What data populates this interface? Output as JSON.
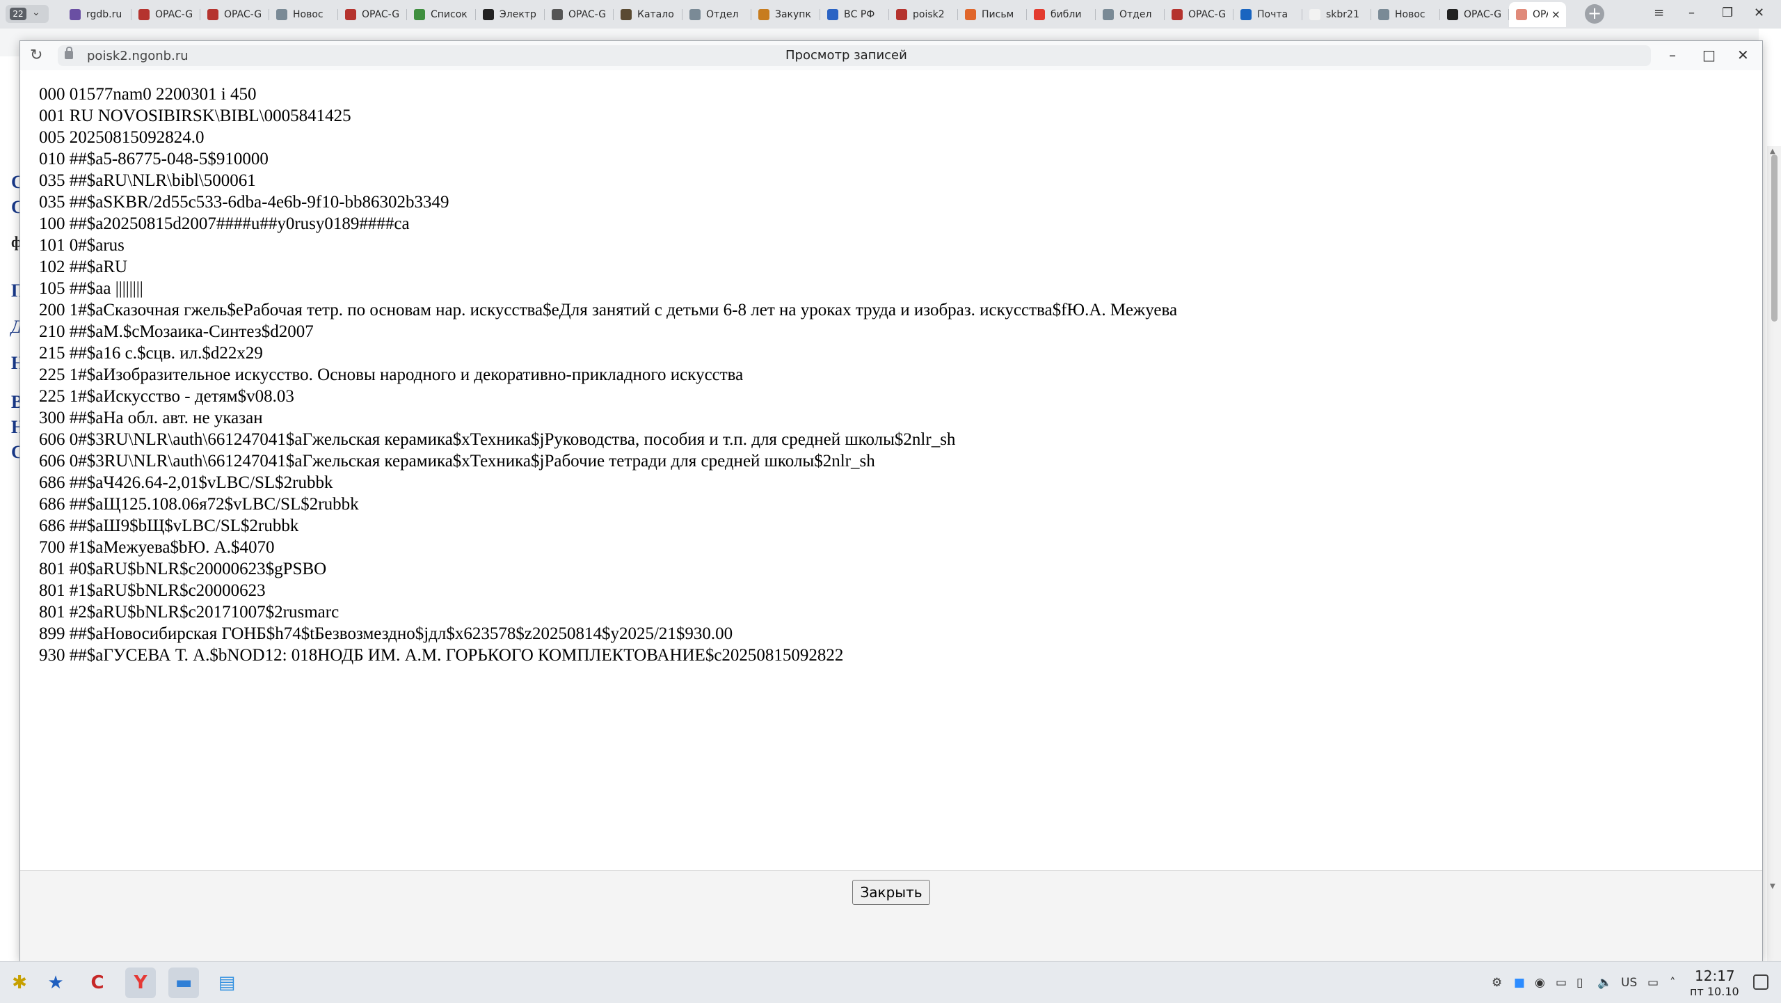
{
  "browser": {
    "tab_count": "22",
    "tabs": [
      {
        "label": "rgdb.ru",
        "icon": "globe-icon",
        "color": "#6a4fa3"
      },
      {
        "label": "OPAC-G",
        "icon": "opac-icon",
        "color": "#b5332e"
      },
      {
        "label": "OPAC-G",
        "icon": "opac-icon",
        "color": "#b5332e"
      },
      {
        "label": "Новос",
        "icon": "page-icon",
        "color": "#7a8a96"
      },
      {
        "label": "OPAC-G",
        "icon": "opac-icon",
        "color": "#b5332e"
      },
      {
        "label": "Список",
        "icon": "leaf-icon",
        "color": "#3f8f3f"
      },
      {
        "label": "Электр",
        "icon": "mail-icon",
        "color": "#222222"
      },
      {
        "label": "OPAC-G",
        "icon": "document-icon",
        "color": "#555555"
      },
      {
        "label": "Катало",
        "icon": "catalog-icon",
        "color": "#5a4a32"
      },
      {
        "label": "Отдел",
        "icon": "page-icon",
        "color": "#7a8a96"
      },
      {
        "label": "Закупк",
        "icon": "procurement-icon",
        "color": "#c77c1e"
      },
      {
        "label": "ВС РФ",
        "icon": "court-icon",
        "color": "#2a63c4"
      },
      {
        "label": "poisk2",
        "icon": "opac-icon",
        "color": "#b5332e"
      },
      {
        "label": "Письм",
        "icon": "mail-icon",
        "color": "#e0662b"
      },
      {
        "label": "библи",
        "icon": "yandex-icon",
        "color": "#e33b2e"
      },
      {
        "label": "Отдел",
        "icon": "page-icon",
        "color": "#7a8a96"
      },
      {
        "label": "OPAC-G",
        "icon": "opac-icon",
        "color": "#b5332e"
      },
      {
        "label": "Почта",
        "icon": "outlook-icon",
        "color": "#1a65c0"
      },
      {
        "label": "skbr21",
        "icon": "square-icon",
        "color": "#f2f2f2"
      },
      {
        "label": "Новос",
        "icon": "page-icon",
        "color": "#7a8a96"
      },
      {
        "label": "OPAC-G",
        "icon": "document-icon",
        "color": "#222222"
      }
    ],
    "active_tab": {
      "label": "OPAC",
      "icon": "opac-icon",
      "color": "#e08a7a",
      "close": "×"
    },
    "new_tab": "+",
    "menu": "≡",
    "minimize": "–",
    "maximize": "❐",
    "close": "✕"
  },
  "background_page": {
    "letters": [
      "C",
      "C",
      "ф",
      "П",
      "Д",
      "Н",
      "В",
      "Н",
      "С"
    ]
  },
  "popup": {
    "url": "poisk2.ngonb.ru",
    "title": "Просмотр записей",
    "reload": "↻",
    "minimize": "–",
    "maximize": "□",
    "close": "✕",
    "record_lines": [
      "000 01577nam0 2200301 i 450",
      "001 RU NOVOSIBIRSK\\BIBL\\0005841425",
      "005 20250815092824.0",
      "010 ##$a5-86775-048-5$910000",
      "035 ##$aRU\\NLR\\bibl\\500061",
      "035 ##$aSKBR/2d55c533-6dba-4e6b-9f10-bb86302b3349",
      "100 ##$a20250815d2007####u##y0rusy0189####ca",
      "101 0#$arus",
      "102 ##$aRU",
      "105 ##$aa ||||||||",
      "200 1#$aСказочная гжель$eРабочая тетр. по основам нар. искусства$eДля занятий с детьми 6-8 лет на уроках труда и изобраз. искусства$fЮ.А. Межуева",
      "210 ##$aМ.$cМозаика-Синтез$d2007",
      "215 ##$a16 с.$cцв. ил.$d22x29",
      "225 1#$aИзобразительное искусство. Основы народного и декоративно-прикладного искусства",
      "225 1#$aИскусство - детям$v08.03",
      "300 ##$aНа обл. авт. не указан",
      "606 0#$3RU\\NLR\\auth\\661247041$aГжельская керамика$xТехника$jРуководства, пособия и т.п. для средней школы$2nlr_sh",
      "606 0#$3RU\\NLR\\auth\\661247041$aГжельская керамика$xТехника$jРабочие тетради для средней школы$2nlr_sh",
      "686 ##$aЧ426.64-2,01$vLBC/SL$2rubbk",
      "686 ##$aЩ125.108.06я72$vLBC/SL$2rubbk",
      "686 ##$aШ9$bЩ$vLBC/SL$2rubbk",
      "700 #1$aМежуева$bЮ. А.$4070",
      "801 #0$aRU$bNLR$c20000623$gPSBO",
      "801 #1$aRU$bNLR$c20000623",
      "801 #2$aRU$bNLR$c20171007$2rusmarc",
      "899 ##$aНовосибирская ГОНБ$h74$tБезвозмездно$jдл$x623578$z20250814$y2025/21$930.00",
      "930 ##$aГУСЕВА Т. А.$bNOD12: 018НОДБ ИМ. А.М. ГОРЬКОГО КОМПЛЕКТОВАНИЕ$c20250815092822"
    ],
    "close_button": "Закрыть"
  },
  "taskbar": {
    "apps": [
      {
        "name": "start-menu-icon",
        "glyph": "✱"
      },
      {
        "name": "star-folder-icon",
        "glyph": "★"
      },
      {
        "name": "c-app-icon",
        "glyph": "C"
      },
      {
        "name": "yandex-browser-icon",
        "glyph": "Y"
      },
      {
        "name": "file-manager-icon",
        "glyph": "▬"
      },
      {
        "name": "document-app-icon",
        "glyph": "▤"
      }
    ],
    "tray": {
      "keyboard_layout": "US",
      "icons": [
        "network-icon",
        "zoom-icon",
        "steam-icon",
        "display-icon",
        "clipboard-icon",
        "volume-icon",
        "screen-icon",
        "expand-icon"
      ]
    },
    "clock_time": "12:17",
    "clock_date": "пт 10.10"
  }
}
